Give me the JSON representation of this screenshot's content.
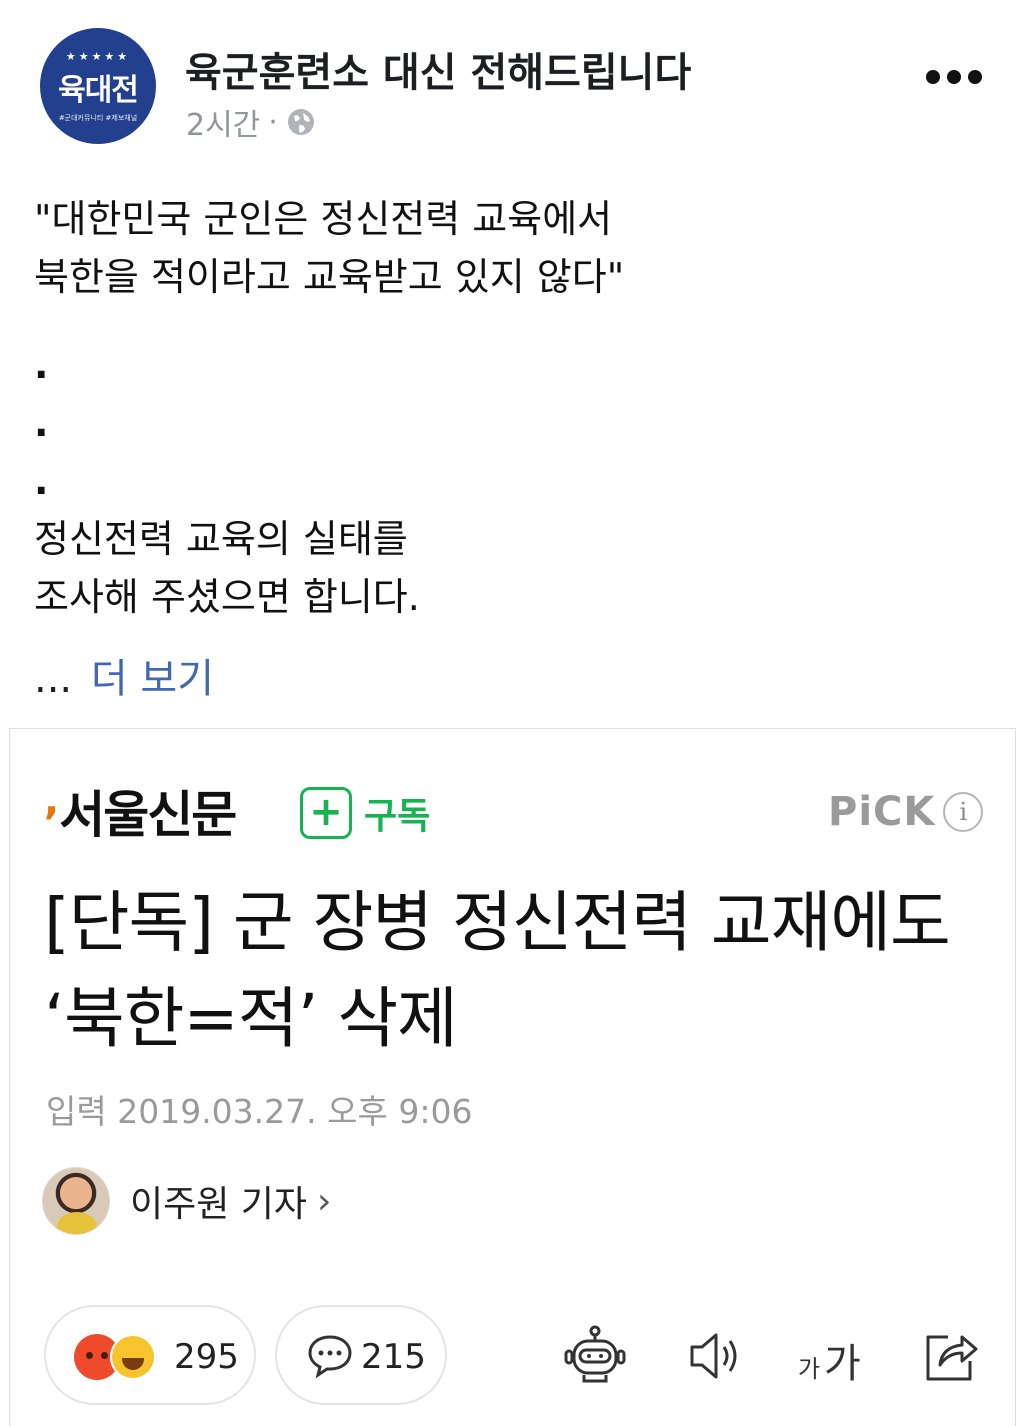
{
  "post": {
    "page_name": "육군훈련소 대신 전해드립니다",
    "avatar_text": "육대전",
    "avatar_subtext": "#군대커뮤니티 #제보채널",
    "time": "2시간",
    "meta_separator": "·",
    "icons": {
      "privacy": "globe-icon",
      "menu": "more-options-icon"
    },
    "body_lines": [
      "\"대한민국 군인은 정신전력 교육에서",
      "북한을 적이라고 교육받고 있지 않다\""
    ],
    "dot_lines": [
      ".",
      ".",
      "."
    ],
    "body_lines_2": [
      "정신전력 교육의 실태를",
      "조사해 주셨으면 합니다."
    ],
    "see_more_prefix": "...",
    "see_more_label": "더 보기"
  },
  "news": {
    "publisher": "서울신문",
    "subscribe_label": "구독",
    "pick_label": "PiCK",
    "info_symbol": "i",
    "headline": "[단독] 군 장병 정신전력 교재에도 ‘북한=적’ 삭제",
    "date": "입력 2019.03.27. 오후 9:06",
    "reporter": "이주원 기자",
    "reporter_chevron": "›",
    "reaction_count": "295",
    "comment_count": "215",
    "font_small": "가",
    "font_big": "가",
    "colors": {
      "accent_green": "#16b350",
      "link_blue": "#4267b2",
      "angry": "#f04a2c",
      "haha": "#f7c42d",
      "avatar_blue": "#23408e"
    },
    "tool_icons": [
      "robot-summary-icon",
      "speaker-icon",
      "font-size-icon",
      "share-icon"
    ]
  }
}
